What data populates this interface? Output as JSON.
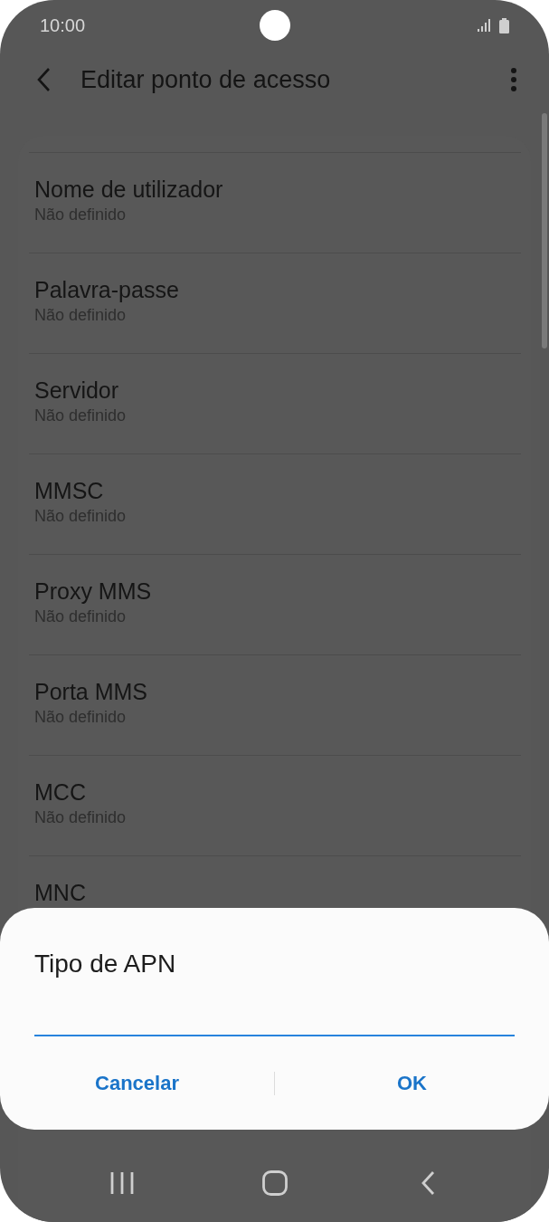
{
  "status_bar": {
    "time": "10:00"
  },
  "toolbar": {
    "title": "Editar ponto de acesso"
  },
  "settings": [
    {
      "title": "Nome de utilizador",
      "value": "Não definido"
    },
    {
      "title": "Palavra-passe",
      "value": "Não definido"
    },
    {
      "title": "Servidor",
      "value": "Não definido"
    },
    {
      "title": "MMSC",
      "value": "Não definido"
    },
    {
      "title": "Proxy MMS",
      "value": "Não definido"
    },
    {
      "title": "Porta MMS",
      "value": "Não definido"
    },
    {
      "title": "MCC",
      "value": "Não definido"
    },
    {
      "title": "MNC"
    }
  ],
  "dialog": {
    "title": "Tipo de APN",
    "buttons": [
      "Cancelar",
      "OK"
    ]
  }
}
